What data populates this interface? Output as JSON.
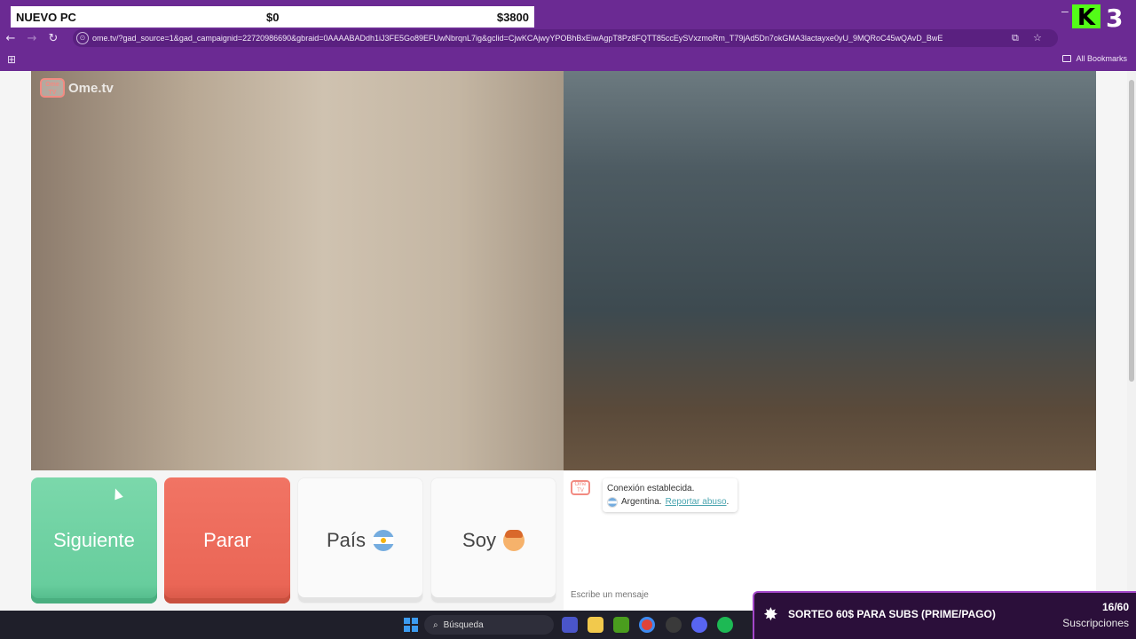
{
  "overlay": {
    "goal_label": "NUEVO PC",
    "goal_current": "$0",
    "goal_target": "$3800",
    "kick_number": "3"
  },
  "browser": {
    "url": "ome.tv/?gad_source=1&gad_campaignid=22720986690&gbraid=0AAAABADdh1iJ3FE5Go89EFUwNbrqnL7ig&gclid=CjwKCAjwyYPOBhBxEiwAgpT8Pz8FQTT85ccEySVxzmoRm_T79jAd5Dn7okGMA3lactayxe0yU_9MQRoC45wQAvD_BwE",
    "bookmarks_label": "All Bookmarks"
  },
  "ometv": {
    "logo_text": "Ome.tv",
    "buttons": {
      "next": "Siguiente",
      "stop": "Parar",
      "country": "País",
      "me": "Soy"
    },
    "chat": {
      "status": "Conexión establecida.",
      "country": "Argentina.",
      "report": "Reportar abuso",
      "report_suffix": ".",
      "input_placeholder": "Escribe un mensaje"
    }
  },
  "giveaway": {
    "title": "SORTEO 60$ PARA SUBS (PRIME/PAGO)",
    "count": "16/60",
    "subtitle": "Suscripciones"
  },
  "taskbar": {
    "search_label": "Búsqueda"
  },
  "colors": {
    "chrome_purple": "#6b2a93",
    "next_green": "#67cd9d",
    "stop_red": "#ea6656",
    "kick_green": "#53fc18"
  }
}
